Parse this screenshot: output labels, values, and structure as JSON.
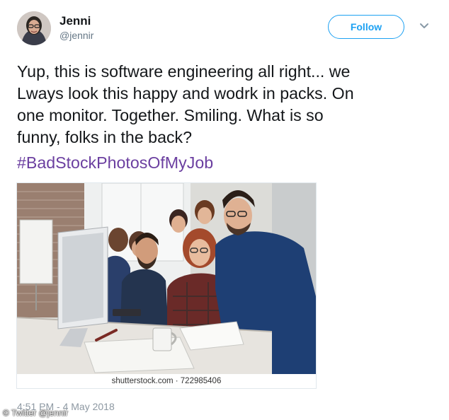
{
  "tweet": {
    "author": {
      "name": "Jenni",
      "handle": "@jennir"
    },
    "follow_label": "Follow",
    "text": "Yup, this is software engineering all right... we\nLways look this happy and wodrk in packs. On\none monitor. Together. Smiling.  What is so\nfunny, folks in the back?",
    "hashtag": "#BadStockPhotosOfMyJob",
    "photo_caption": "shutterstock.com · 722985406",
    "timestamp": "4:51 PM - 4 May 2018"
  },
  "watermark": "© Twitter @jennir",
  "colors": {
    "accent": "#1da1f2",
    "hashtag": "#6b3fa0",
    "muted": "#657786"
  },
  "icons": {
    "caret": "chevron-down-icon"
  }
}
